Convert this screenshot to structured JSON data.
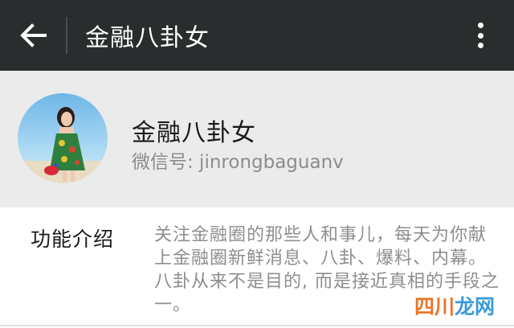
{
  "header": {
    "title": "金融八卦女",
    "back_icon": "arrow-left-icon",
    "menu_icon": "more-vertical-icon"
  },
  "profile": {
    "name": "金融八卦女",
    "wechat_id": "微信号: jinrongbaguanv"
  },
  "intro": {
    "label": "功能介绍",
    "text": "关注金融圈的那些人和事儿，每天为你献上金融圈新鲜消息、八卦、爆料、内幕。 八卦从来不是目的, 而是接近真相的手段之一。"
  },
  "watermark": {
    "part1": "四川",
    "part2": "龙网"
  },
  "colors": {
    "topbar": "#2a2d2e",
    "profile_bg": "#ebebeb",
    "muted_text": "#8e8e8e"
  }
}
